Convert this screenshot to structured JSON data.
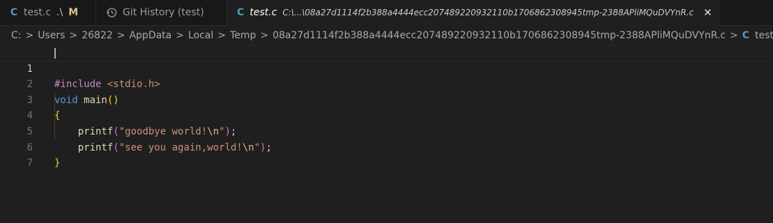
{
  "tabs": [
    {
      "icon": "C",
      "label": "test.c",
      "detail": ".\\",
      "status": "M"
    },
    {
      "icon": "history-icon",
      "label": "Git History (test)"
    },
    {
      "icon": "C",
      "label": "test.c",
      "path": "C:\\...\\08a27d1114f2b388a4444ecc207489220932110b1706862308945tmp-2388APliMQuDVYnR.c",
      "close": "✕"
    }
  ],
  "breadcrumb": {
    "items": [
      "C:",
      "Users",
      "26822",
      "AppData",
      "Local",
      "Temp",
      "08a27d1114f2b388a4444ecc207489220932110b1706862308945tmp-2388APliMQuDVYnR.c"
    ],
    "file_icon": "C",
    "file": "test.c",
    "more": "...",
    "separator": ">"
  },
  "editor": {
    "line_numbers": [
      "1",
      "2",
      "3",
      "4",
      "5",
      "6",
      "7"
    ],
    "lines": [
      {
        "a": "#include",
        "b": " <stdio.h>"
      },
      {
        "a": "void",
        "b": " main",
        "c": "()"
      },
      {
        "a": "{"
      },
      {
        "indent": "    ",
        "fn": "printf",
        "open": "(",
        "str": "\"goodbye world!",
        "esc": "\\n",
        "strend": "\"",
        "close": ")",
        "end": ";"
      },
      {
        "indent": "    ",
        "fn": "printf",
        "open": "(",
        "str": "\"see you again,world!",
        "esc": "\\n",
        "strend": "\"",
        "close": ")",
        "end": ";"
      },
      {
        "a": "}"
      },
      {
        "a": ""
      }
    ]
  },
  "colors": {
    "background": "#1f1f1f",
    "c_icon": "#519aba",
    "modified": "#e2c08d"
  }
}
